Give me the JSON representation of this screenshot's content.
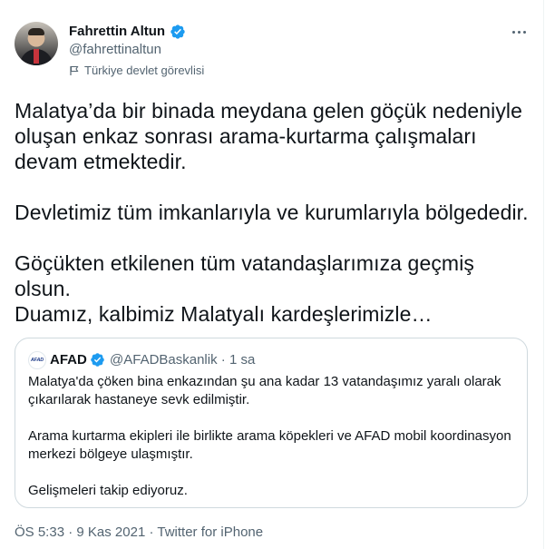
{
  "author": {
    "name": "Fahrettin Altun",
    "handle": "@fahrettinaltun",
    "label": "Türkiye devlet görevlisi"
  },
  "tweet": {
    "lines": [
      "Malatya’da bir binada meydana gelen göçük nedeniyle",
      "oluşan enkaz sonrası arama-kurtarma çalışmaları",
      "devam etmektedir.",
      "Devletimiz tüm imkanlarıyla ve kurumlarıyla bölgededir.",
      "Göçükten etkilenen tüm vatandaşlarımıza geçmiş",
      "olsun.",
      "Duamız, kalbimiz Malatyalı kardeşlerimizle…"
    ]
  },
  "quote": {
    "logo_text": "AFAD",
    "name": "AFAD",
    "handle": "@AFADBaskanlik",
    "separator": "·",
    "time": "1 sa",
    "lines": [
      "Malatya'da çöken bina enkazından şu ana kadar 13 vatandaşımız yaralı olarak",
      "çıkarılarak hastaneye sevk edilmiştir.",
      "Arama kurtarma ekipleri ile birlikte arama köpekleri ve AFAD mobil koordinasyon",
      "merkezi bölgeye ulaşmıştır.",
      "Gelişmeleri takip ediyoruz."
    ]
  },
  "footer": {
    "time": "ÖS 5:33",
    "separator": "·",
    "date": "9 Kas 2021",
    "source": "Twitter for iPhone"
  },
  "colors": {
    "text": "#0f1419",
    "secondary": "#536471",
    "verified": "#1d9bf0",
    "border": "#cfd9de"
  },
  "icons": [
    "verified-badge-icon",
    "flag-icon",
    "more-options-icon",
    "afad-logo-icon"
  ]
}
